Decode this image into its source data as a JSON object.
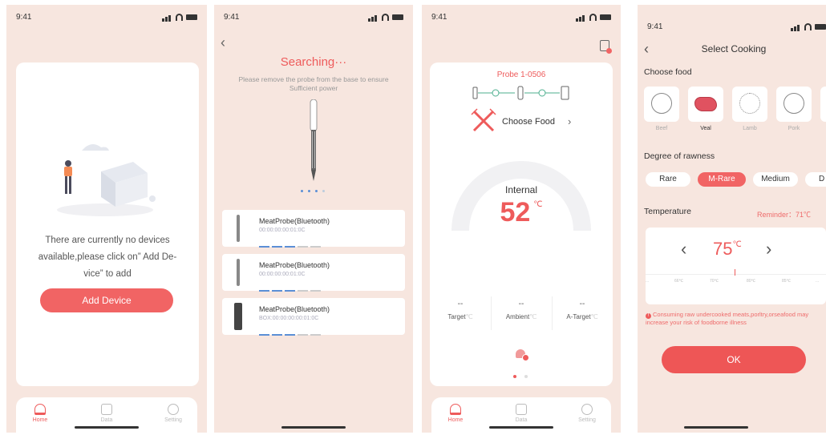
{
  "status": {
    "time": "9:41"
  },
  "tabs": {
    "home": "Home",
    "data": "Data",
    "setting": "Setting"
  },
  "screen1": {
    "empty_message": "There are currently no devices available,please click on” Add De-vice” to add",
    "add_button": "Add Device"
  },
  "screen2": {
    "title": "Searching···",
    "hint": "Please remove the probe from the base to ensure Sufficient power",
    "devices": [
      {
        "name": "MeatProbe(Bluetooth)",
        "mac": "00:00:00:00:01:0C"
      },
      {
        "name": "MeatProbe(Bluetooth)",
        "mac": "00:00:00:00:01:0C"
      },
      {
        "name": "MeatProbe(Bluetooth)",
        "mac": "BOX:00:00:00:00:01:0C"
      }
    ]
  },
  "screen3": {
    "probe_title": "Probe 1-0506",
    "choose_food": "Choose Food",
    "gauge_label": "Internal",
    "internal_value": "52",
    "unit": "℃",
    "stats": [
      {
        "value": "--",
        "label": "Target"
      },
      {
        "value": "--",
        "label": "Ambient"
      },
      {
        "value": "--",
        "label": "A-Target"
      }
    ],
    "stat_unit": "℃"
  },
  "screen4": {
    "title": "Select Cooking",
    "choose_food": "Choose food",
    "foods": [
      "Beef",
      "Veal",
      "Lamb",
      "Pork"
    ],
    "selected_food": "Veal",
    "doneness_heading": "Degree of rawness",
    "doneness": [
      "Rare",
      "M-Rare",
      "Medium",
      "D"
    ],
    "selected_doneness": "M-Rare",
    "temperature_heading": "Temperature",
    "reminder": "Reminder：71℃",
    "temperature_value": "75",
    "temperature_unit": "℃",
    "ruler_ticks": [
      "...",
      "66℃",
      "70℃",
      "",
      "80℃",
      "85℃",
      "..."
    ],
    "warning": "Consuming raw undercooked meats,porltry,orseafood may increase your risk of foodborne illness",
    "ok_button": "OK"
  },
  "colors": {
    "accent": "#f16464",
    "background": "#f7e6df",
    "link_blue": "#5b8fd6",
    "probe_green": "#4caf8e"
  }
}
